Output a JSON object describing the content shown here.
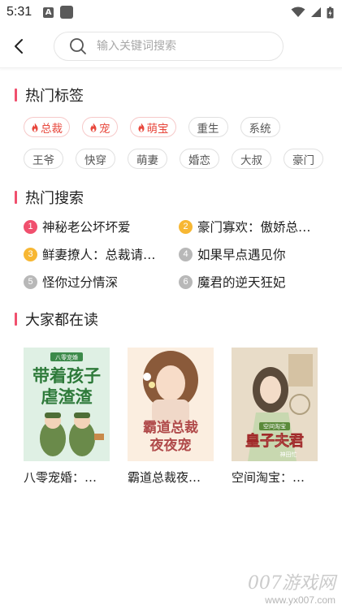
{
  "status_bar": {
    "time": "5:31",
    "notif_icon_letter": "A"
  },
  "search": {
    "placeholder": "输入关键词搜索"
  },
  "hot_tags": {
    "title": "热门标签",
    "row1": [
      {
        "label": "总裁",
        "hot": true
      },
      {
        "label": "宠",
        "hot": true
      },
      {
        "label": "萌宝",
        "hot": true
      },
      {
        "label": "重生",
        "hot": false
      },
      {
        "label": "系统",
        "hot": false
      }
    ],
    "row2": [
      {
        "label": "王爷",
        "hot": false
      },
      {
        "label": "快穿",
        "hot": false
      },
      {
        "label": "萌妻",
        "hot": false
      },
      {
        "label": "婚恋",
        "hot": false
      },
      {
        "label": "大叔",
        "hot": false
      },
      {
        "label": "豪门",
        "hot": false
      }
    ]
  },
  "hot_search": {
    "title": "热门搜索",
    "items": [
      {
        "rank": "1",
        "text": "神秘老公坏坏爱",
        "color": "#f0506e"
      },
      {
        "rank": "2",
        "text": "豪门寡欢：傲娇总…",
        "color": "#f7b733"
      },
      {
        "rank": "3",
        "text": "鲜妻撩人：总裁请…",
        "color": "#f7b733"
      },
      {
        "rank": "4",
        "text": "如果早点遇见你",
        "color": "#b8b8b8"
      },
      {
        "rank": "5",
        "text": "怪你过分情深",
        "color": "#b8b8b8"
      },
      {
        "rank": "6",
        "text": "魔君的逆天狂妃",
        "color": "#b8b8b8"
      }
    ]
  },
  "reading": {
    "title": "大家都在读",
    "books": [
      {
        "title": "八零宠婚：…",
        "cover_text": "带着孩子虐渣渣",
        "cover_badge": "八零宠婚",
        "theme": "green"
      },
      {
        "title": "霸道总裁夜…",
        "cover_text": "霸道总裁夜夜宠",
        "theme": "peach"
      },
      {
        "title": "空间淘宝：…",
        "cover_text": "皇子夫君",
        "cover_badge": "空间淘宝",
        "cover_author": "神田忙",
        "theme": "warm"
      }
    ]
  },
  "watermark": {
    "main": "007游戏网",
    "sub": "www.yx007.com"
  },
  "colors": {
    "accent": "#f0506e",
    "hot_tag": "#e8473c",
    "rank_gold": "#f7b733",
    "rank_gray": "#b8b8b8"
  }
}
